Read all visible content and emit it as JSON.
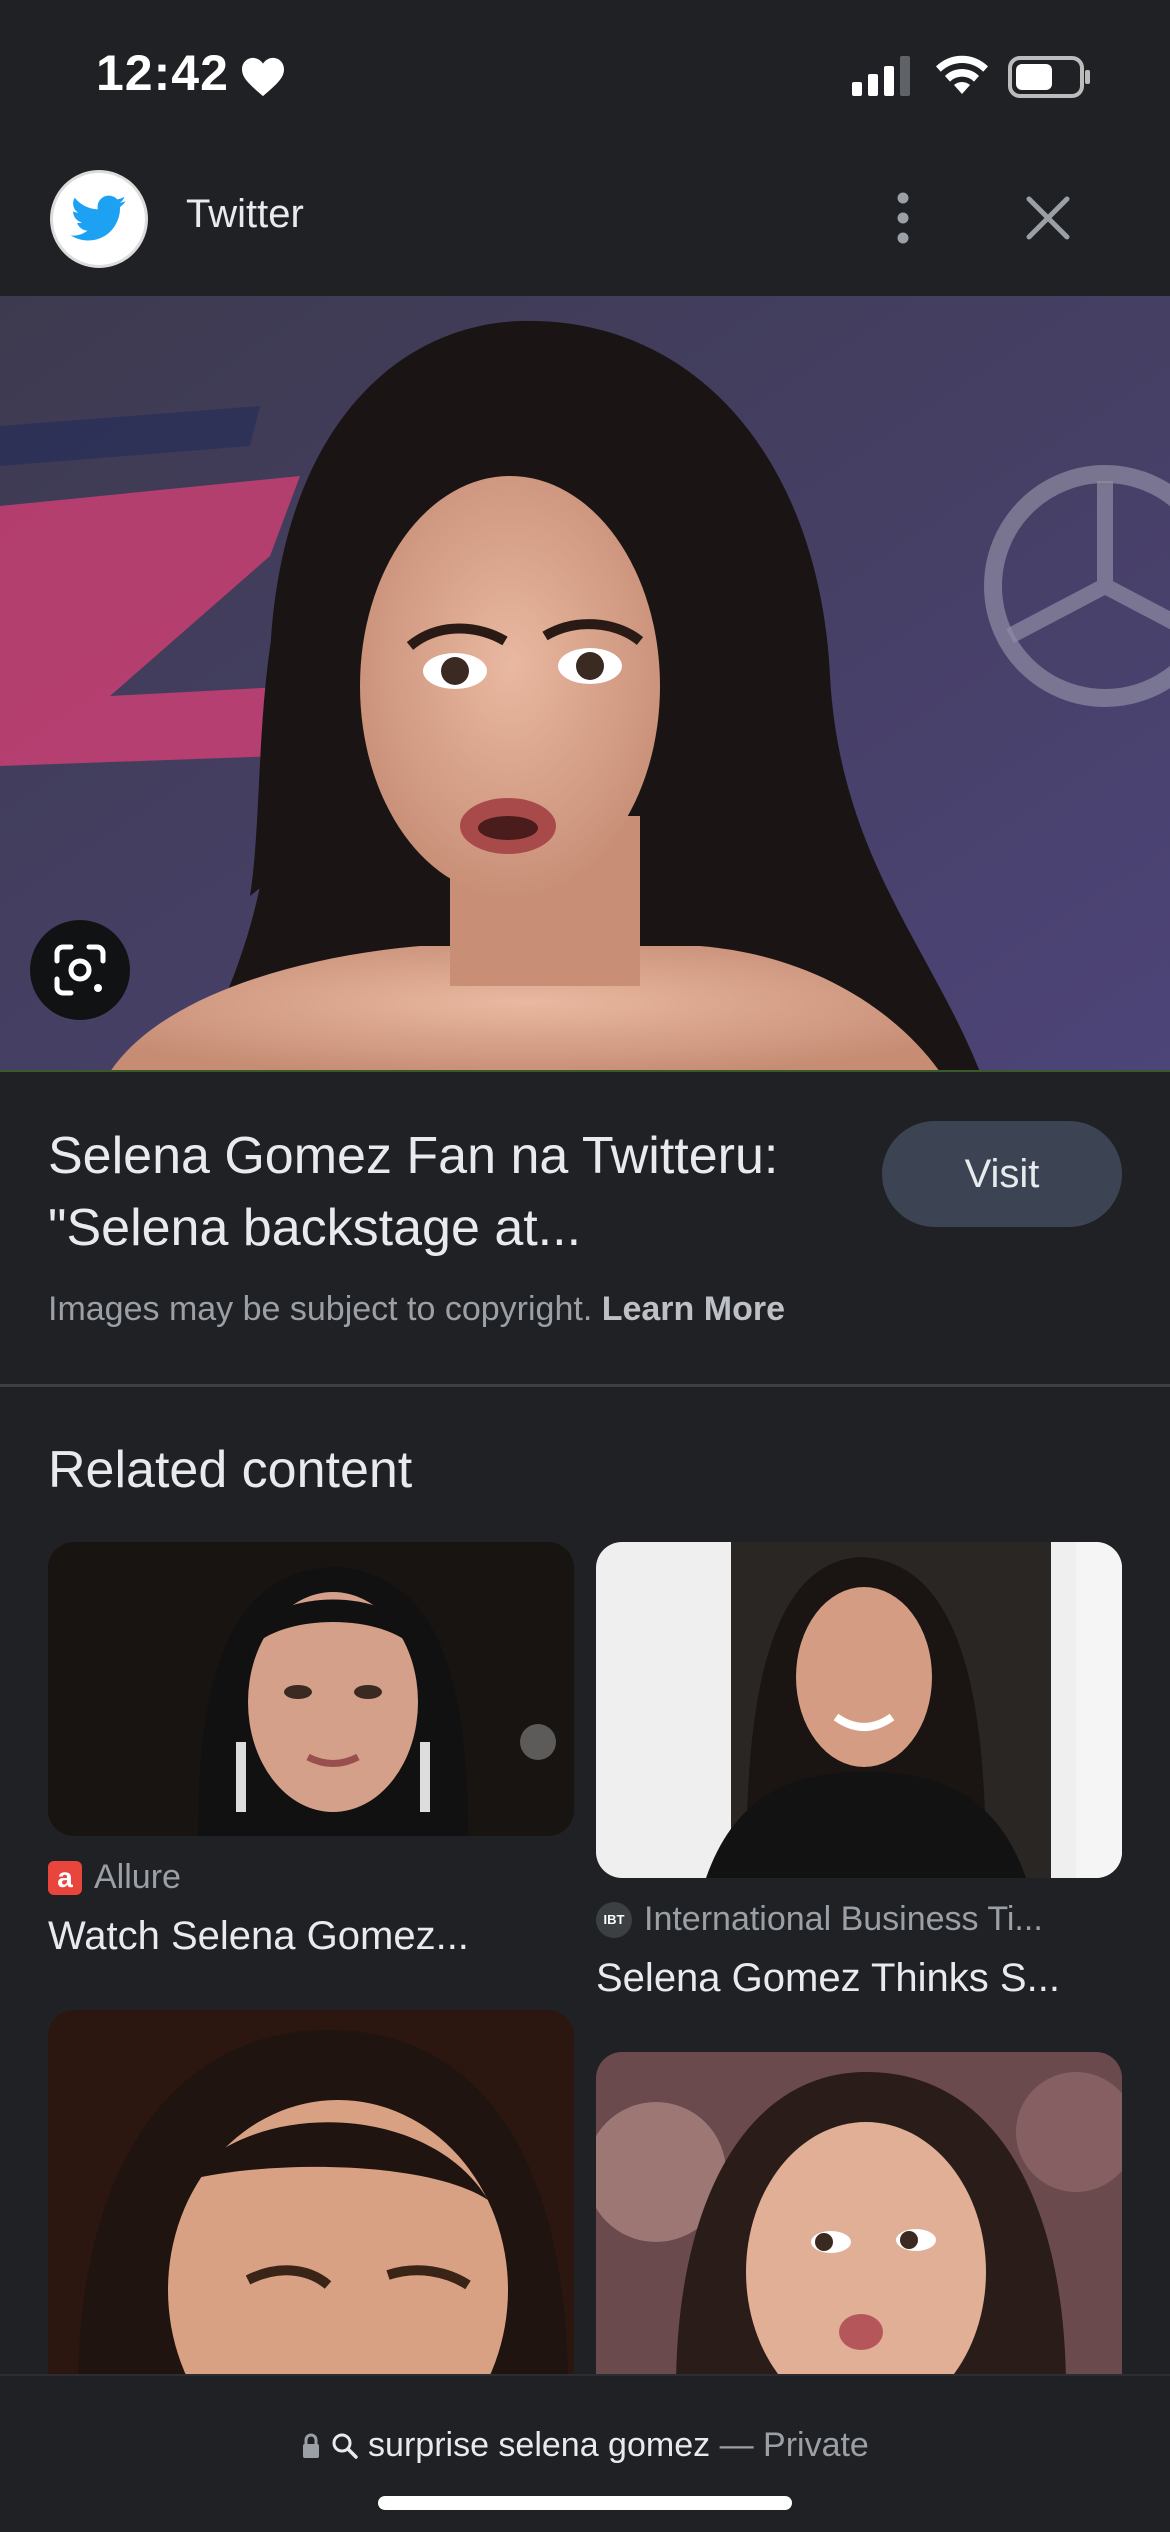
{
  "status_bar": {
    "time": "12:42",
    "icons": [
      "heart-icon",
      "cellular-signal-icon",
      "wifi-icon",
      "battery-icon"
    ]
  },
  "header": {
    "source_name": "Twitter",
    "source_icon": "twitter-bird-icon",
    "more_icon": "vertical-dots-icon",
    "close_icon": "close-icon",
    "brand_color": "#1da1f2"
  },
  "main_image": {
    "lens_icon": "google-lens-icon"
  },
  "result": {
    "title": "Selena Gomez Fan na Twitteru: \"Selena backstage at...",
    "visit_label": "Visit",
    "copyright_text": "Images may be subject to copyright.",
    "learn_more_label": "Learn More"
  },
  "related": {
    "heading": "Related content",
    "cards": [
      {
        "source": "Allure",
        "title": "Watch Selena Gomez...",
        "source_icon": "allure-logo-icon"
      },
      {
        "source": "International Business Ti...",
        "title": "Selena Gomez Thinks S...",
        "source_icon": "ibt-logo-icon",
        "logo_text": "IBT"
      },
      {
        "source": "",
        "title": ""
      },
      {
        "source": "",
        "title": ""
      }
    ]
  },
  "bottom_bar": {
    "query": "surprise selena gomez",
    "separator": "—",
    "mode": "Private",
    "icons": [
      "lock-icon",
      "search-icon"
    ]
  }
}
